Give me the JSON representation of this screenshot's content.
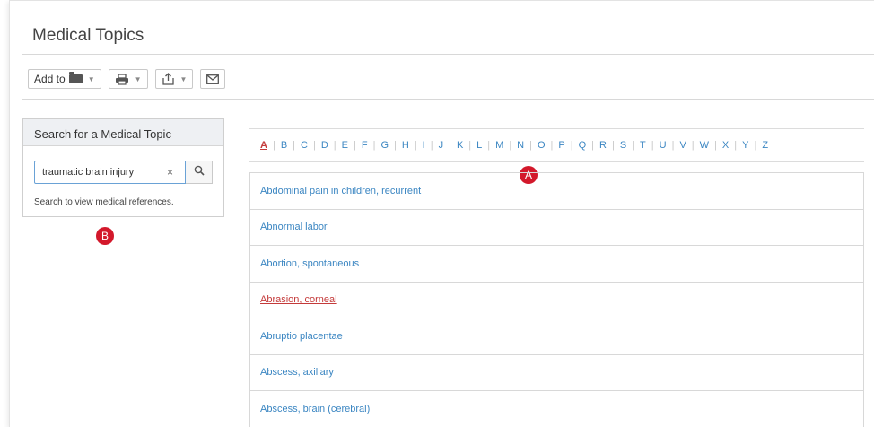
{
  "page": {
    "title": "Medical Topics"
  },
  "toolbar": {
    "add_to_label": "Add to",
    "add_to_icon": "folder-icon",
    "print_icon": "printer-icon",
    "export_icon": "export-icon",
    "email_icon": "envelope-icon"
  },
  "search": {
    "panel_title": "Search for a Medical Topic",
    "value": "traumatic brain injury",
    "clear_label": "×",
    "hint": "Search to view medical references."
  },
  "alphabet": {
    "active": "A",
    "letters": [
      "A",
      "B",
      "C",
      "D",
      "E",
      "F",
      "G",
      "H",
      "I",
      "J",
      "K",
      "L",
      "M",
      "N",
      "O",
      "P",
      "Q",
      "R",
      "S",
      "T",
      "U",
      "V",
      "W",
      "X",
      "Y",
      "Z"
    ]
  },
  "topics": [
    {
      "label": "Abdominal pain in children, recurrent",
      "visited": false
    },
    {
      "label": "Abnormal labor",
      "visited": false
    },
    {
      "label": "Abortion, spontaneous",
      "visited": false
    },
    {
      "label": "Abrasion, corneal",
      "visited": true
    },
    {
      "label": "Abruptio placentae",
      "visited": false
    },
    {
      "label": "Abscess, axillary",
      "visited": false
    },
    {
      "label": "Abscess, brain (cerebral)",
      "visited": false
    }
  ],
  "callouts": {
    "a": "A",
    "b": "B"
  },
  "colors": {
    "link": "#3b86c2",
    "active": "#c43a3a",
    "callout": "#d3182b",
    "focus_border": "#6aa2d6"
  }
}
